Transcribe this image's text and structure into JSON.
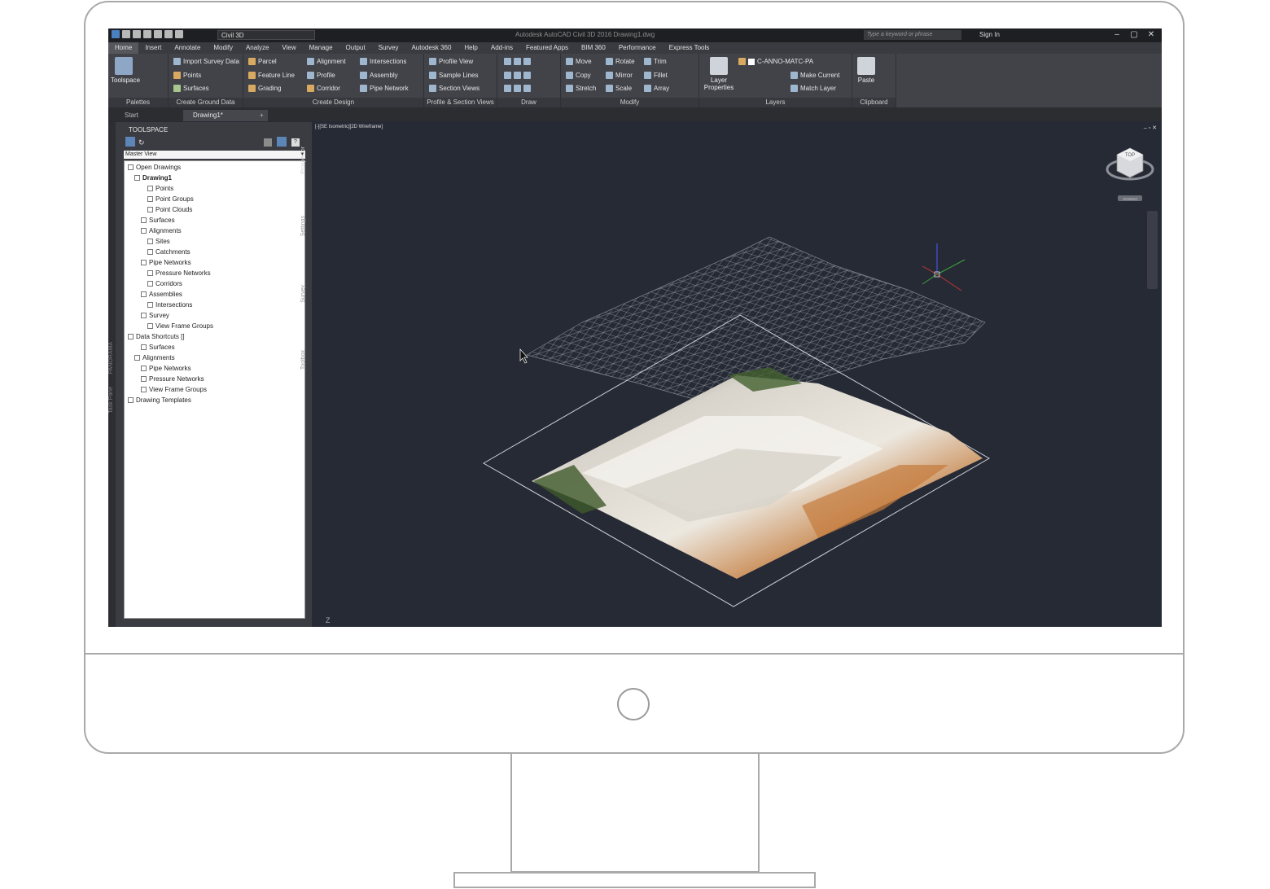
{
  "titlebar": {
    "workspace": "Civil 3D",
    "app_title": "Autodesk AutoCAD Civil 3D 2016   Drawing1.dwg",
    "search_placeholder": "Type a keyword or phrase",
    "signin": "Sign In"
  },
  "menu": {
    "tabs": [
      "Home",
      "Insert",
      "Annotate",
      "Modify",
      "Analyze",
      "View",
      "Manage",
      "Output",
      "Survey",
      "Autodesk 360",
      "Help",
      "Add-ins",
      "Featured Apps",
      "BIM 360",
      "Performance",
      "Express Tools"
    ]
  },
  "ribbon": {
    "toolspace": "Toolspace",
    "import_survey": "Import Survey Data",
    "points": "Points",
    "surfaces": "Surfaces",
    "parcel": "Parcel",
    "feature_line": "Feature Line",
    "grading": "Grading",
    "alignment": "Alignment",
    "profile": "Profile",
    "corridor": "Corridor",
    "intersections": "Intersections",
    "assembly": "Assembly",
    "pipe_network": "Pipe Network",
    "profile_view": "Profile View",
    "sample_lines": "Sample Lines",
    "section_views": "Section Views",
    "move": "Move",
    "copy": "Copy",
    "stretch": "Stretch",
    "rotate": "Rotate",
    "mirror": "Mirror",
    "scale": "Scale",
    "trim": "Trim",
    "fillet": "Fillet",
    "array": "Array",
    "layer_properties_line1": "Layer",
    "layer_properties_line2": "Properties",
    "layer_name": "C-ANNO-MATC-PA",
    "make_current": "Make Current",
    "match_layer": "Match Layer",
    "paste": "Paste",
    "panels": {
      "palettes": "Palettes",
      "create_ground": "Create Ground Data",
      "create_design": "Create Design",
      "profile_section": "Profile & Section Views",
      "draw": "Draw",
      "modify": "Modify",
      "layers": "Layers",
      "clipboard": "Clipboard"
    }
  },
  "doctabs": {
    "start": "Start",
    "drawing": "Drawing1*"
  },
  "toolspace": {
    "title": "TOOLSPACE",
    "view": "Master View",
    "tree": [
      "Open Drawings",
      "Drawing1",
      "Points",
      "Point Groups",
      "Point Clouds",
      "Surfaces",
      "Alignments",
      "Sites",
      "Catchments",
      "Pipe Networks",
      "Pressure Networks",
      "Corridors",
      "Assemblies",
      "Intersections",
      "Survey",
      "View Frame Groups",
      "Data Shortcuts []",
      "Surfaces",
      "Alignments",
      "Pipe Networks",
      "Pressure Networks",
      "View Frame Groups",
      "Drawing Templates"
    ],
    "vtabs": [
      "Prospector",
      "Settings",
      "Survey",
      "Toolbox"
    ],
    "side_strip": [
      "PANORAMA",
      "Task Pane"
    ]
  },
  "viewport": {
    "label": "[-][SE Isometric][2D Wireframe]",
    "z_label": "Z",
    "viewcube_face": "TOP",
    "viewcube_badge": "Unnamed"
  }
}
